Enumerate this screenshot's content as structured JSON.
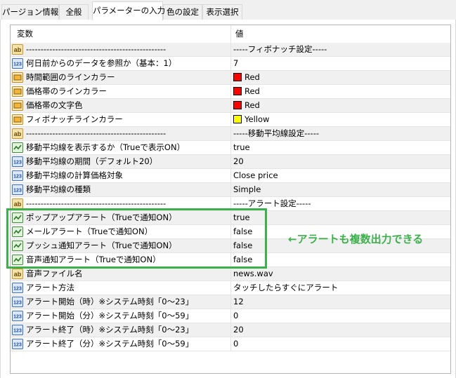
{
  "tabs": [
    {
      "label": "パージョン情報"
    },
    {
      "label": "全般"
    },
    {
      "label": "パラメーターの入力"
    },
    {
      "label": "色の設定"
    },
    {
      "label": "表示選択"
    }
  ],
  "active_tab": 2,
  "grid": {
    "header_name": "変数",
    "header_value": "値"
  },
  "rows": [
    {
      "icon": "ab-icon",
      "name": "------------------------------------------------",
      "value": "-----フィボナッチ設定-----"
    },
    {
      "icon": "123-icon",
      "name": "何日前からのデータを参照か（基本：1）",
      "value": "7"
    },
    {
      "icon": "color-icon",
      "name": "時間範囲のラインカラー",
      "value": "Red",
      "swatch": "#ff0000"
    },
    {
      "icon": "color-icon",
      "name": "価格帯のラインカラー",
      "value": "Red",
      "swatch": "#ff0000"
    },
    {
      "icon": "color-icon",
      "name": "価格帯の文字色",
      "value": "Red",
      "swatch": "#ff0000"
    },
    {
      "icon": "color-icon",
      "name": "フィボナッチラインカラー",
      "value": "Yellow",
      "swatch": "#ffff00"
    },
    {
      "icon": "ab-icon",
      "name": "------------------------------------------------",
      "value": "-----移動平均線設定-----"
    },
    {
      "icon": "bool-icon",
      "name": "移動平均線を表示するか（Trueで表示ON）",
      "value": "true"
    },
    {
      "icon": "123-icon",
      "name": "移動平均線の期間（デフォルト20）",
      "value": "20"
    },
    {
      "icon": "123-icon",
      "name": "移動平均線の計算価格対象",
      "value": "Close price"
    },
    {
      "icon": "123-icon",
      "name": "移動平均線の種類",
      "value": "Simple"
    },
    {
      "icon": "ab-icon",
      "name": "------------------------------------------------",
      "value": "-----アラート設定-----"
    },
    {
      "icon": "bool-icon",
      "name": "ポップアップアラート（Trueで通知ON）",
      "value": "true"
    },
    {
      "icon": "bool-icon",
      "name": "メールアラート（Trueで通知ON）",
      "value": "false"
    },
    {
      "icon": "bool-icon",
      "name": "プッシュ通知アラート（Trueで通知ON）",
      "value": "false"
    },
    {
      "icon": "bool-icon",
      "name": "音声通知アラート（Trueで通知ON）",
      "value": "false"
    },
    {
      "icon": "ab-icon",
      "name": "音声ファイル名",
      "value": "news.wav"
    },
    {
      "icon": "123-icon",
      "name": "アラート方法",
      "value": "タッチしたらすぐにアラート"
    },
    {
      "icon": "123-icon",
      "name": "アラート開始（時）※システム時刻「0～23」",
      "value": "12"
    },
    {
      "icon": "123-icon",
      "name": "アラート開始（分）※システム時刻「0～59」",
      "value": "0"
    },
    {
      "icon": "123-icon",
      "name": "アラート終了（時）※システム時刻「0～23」",
      "value": "20"
    },
    {
      "icon": "123-icon",
      "name": "アラート終了（分）※システム時刻「0～59」",
      "value": "0"
    }
  ],
  "annotation": "←アラートも複数出力できる",
  "colors": {
    "highlight": "#3cb04b",
    "alt_row": "#f0f0f0"
  }
}
